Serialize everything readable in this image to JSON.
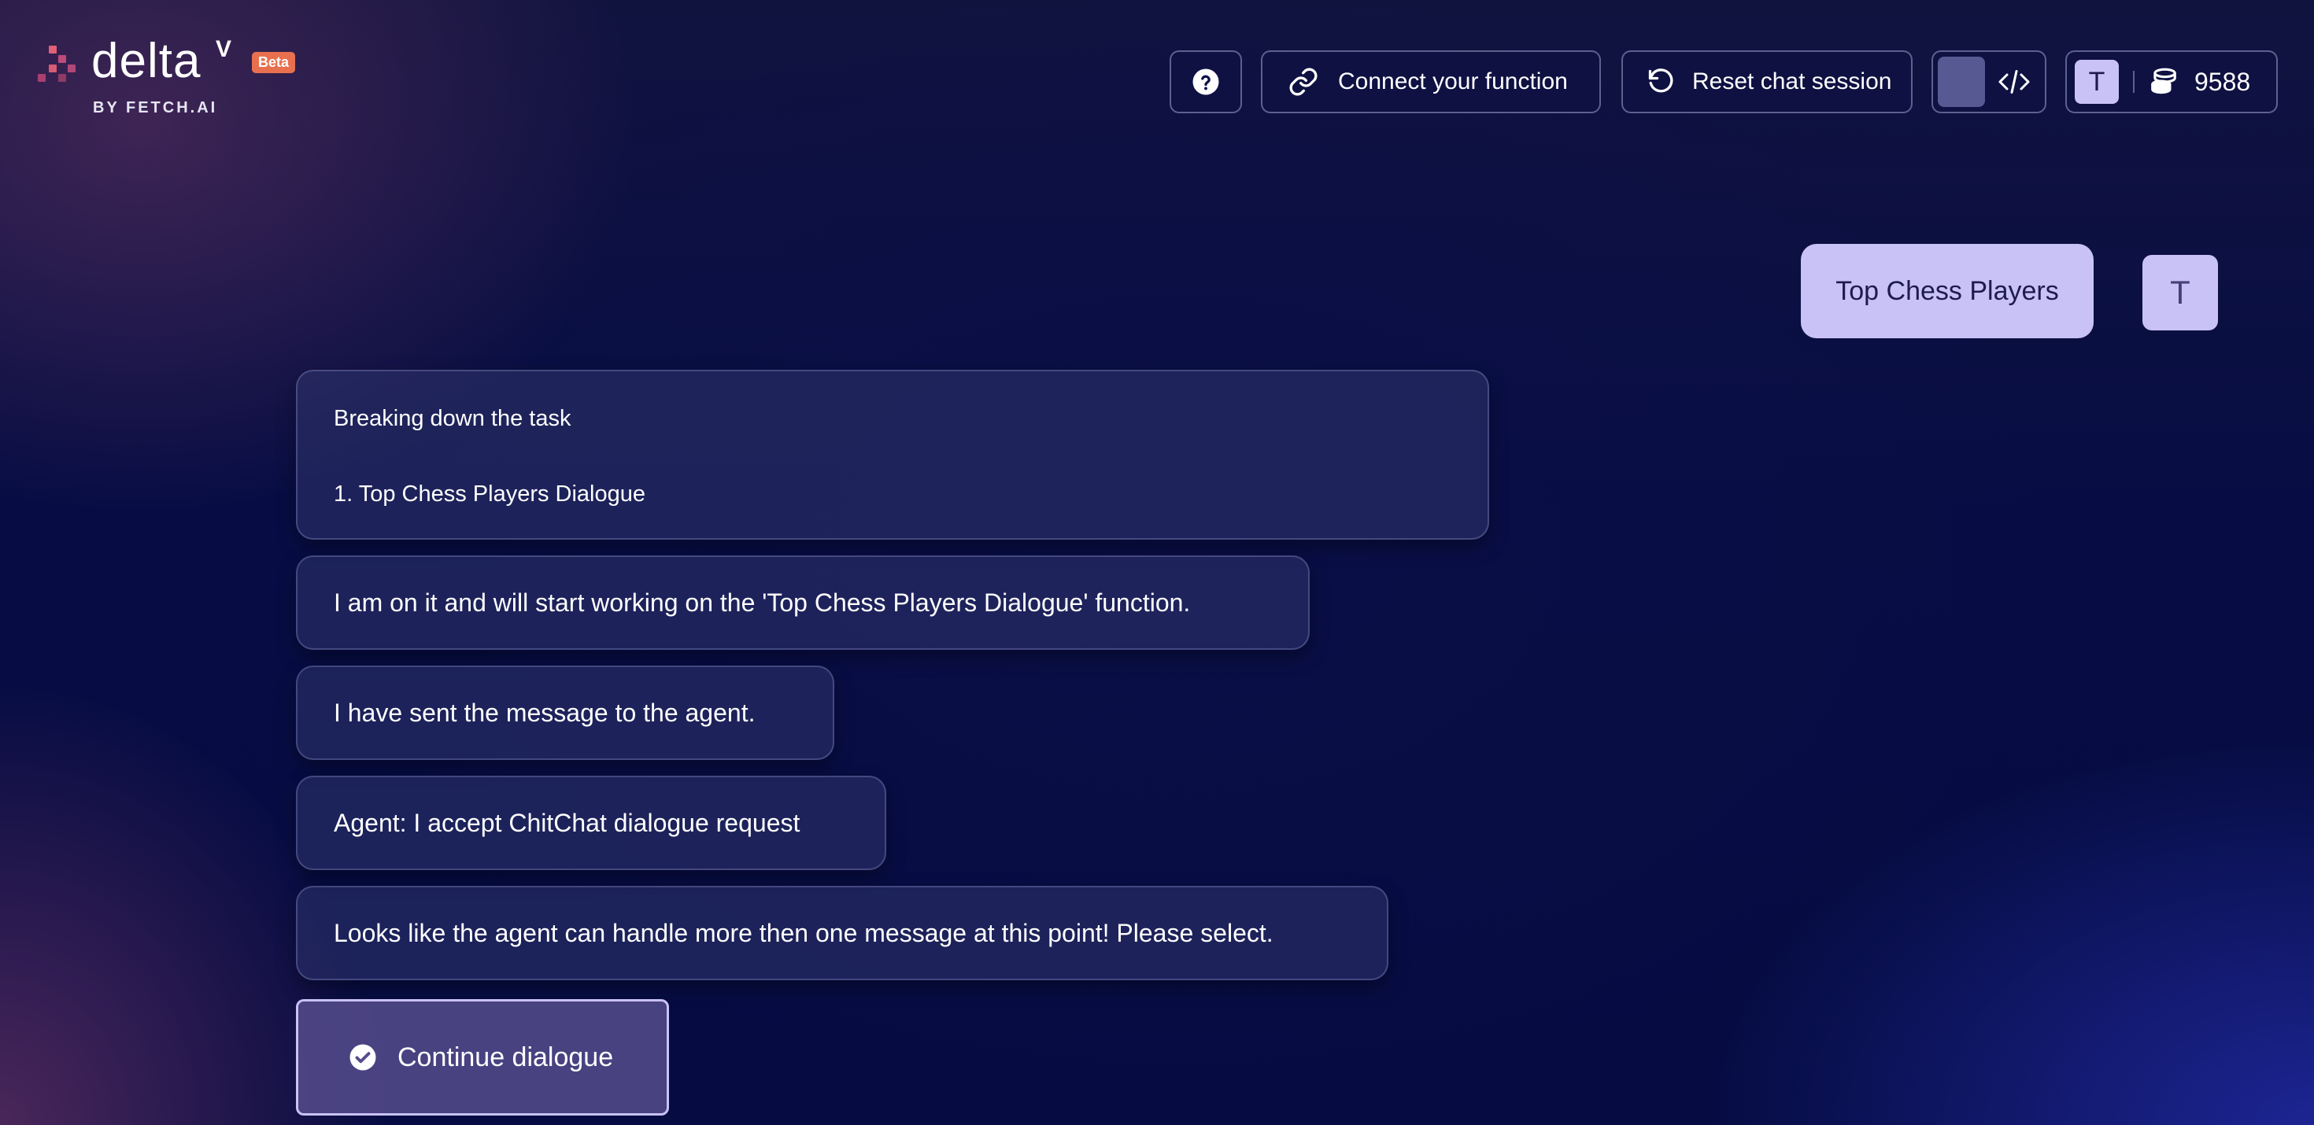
{
  "logo": {
    "word": "delta",
    "superscript": "V",
    "badge": "Beta",
    "byline": "BY FETCH.AI"
  },
  "header": {
    "help_icon": "question-circle-icon",
    "connect_label": "Connect your function",
    "connect_icon": "link-icon",
    "reset_label": "Reset chat session",
    "reset_icon": "rotate-ccw-icon",
    "code_icon": "code-icon",
    "user_initial": "T",
    "credits_icon": "coins-icon",
    "credits": "9588"
  },
  "chat": {
    "user_message": "Top Chess Players",
    "user_avatar_initial": "T",
    "task_header": "Breaking down the task",
    "task_items": [
      "1. Top Chess Players Dialogue"
    ],
    "messages": [
      "I am on it and will start working on the 'Top Chess Players Dialogue' function.",
      "I have sent the message to the agent.",
      "Agent: I accept ChitChat dialogue request",
      "Looks like the agent can handle more then one message at this point! Please select."
    ],
    "options": [
      {
        "label": "Continue dialogue",
        "selected": true
      }
    ]
  },
  "colors": {
    "accent": "#c9c2f6",
    "beta_badge": "#e8704e",
    "background": "#070d44"
  }
}
